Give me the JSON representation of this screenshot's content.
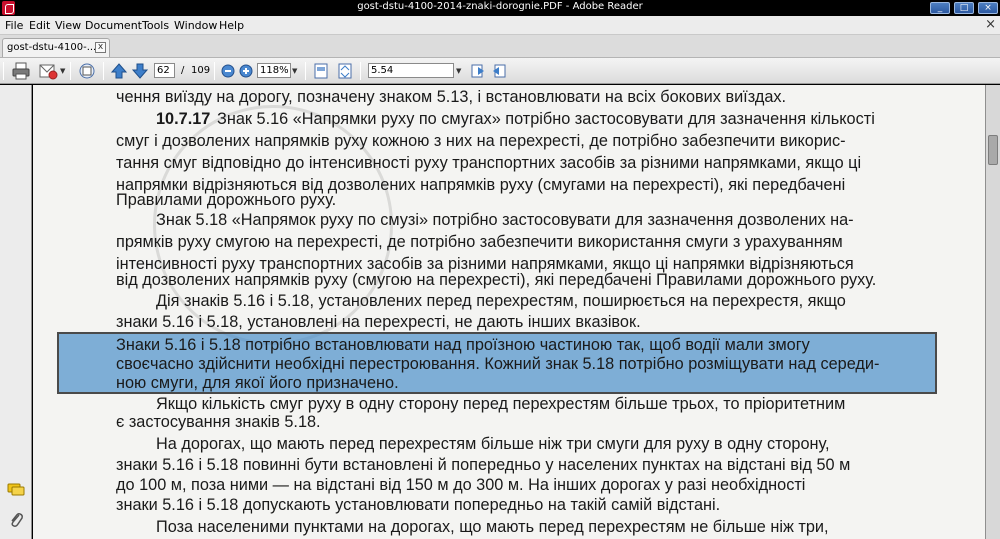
{
  "window": {
    "title": "gost-dstu-4100-2014-znaki-dorognie.PDF - Adobe Reader",
    "minimize": "_",
    "maximize": "□",
    "close": "×"
  },
  "menu": {
    "items": [
      "File",
      "Edit",
      "View",
      "Document",
      "Tools",
      "Window",
      "Help"
    ],
    "close": "×"
  },
  "tab": {
    "label": "gost-dstu-4100-...",
    "close": "x"
  },
  "toolbar": {
    "page_current": "62",
    "page_separator": "/",
    "page_total": "109",
    "zoom": "118%",
    "search": "5.54"
  },
  "document": {
    "lines": [
      "чення виїзду на дорогу, позначену знаком 5.13, і встановлювати на всіх бокових виїздах.",
      "10.7.17",
      "Знак 5.16 «Напрямки руху по смугах» потрібно застосовувати для зазначення кількості",
      "смуг і дозволених напрямків руху кожною з них на перехресті, де потрібно забезпечити викорис-",
      "тання смуг відповідно до інтенсивності руху транспортних засобів за різними напрямками, якщо ці",
      "напрямки відрізняються від дозволених напрямків руху (смугами на перехресті), які передбачені",
      "Правилами дорожнього руху.",
      "Знак 5.18 «Напрямок руху по смузі» потрібно застосовувати для зазначення дозволених на-",
      "прямків руху смугою на перехресті, де потрібно забезпечити використання смуги з урахуванням",
      "інтенсивності руху транспортних засобів за різними напрямками, якщо ці напрямки відрізняються",
      "від дозволених напрямків руху (смугою на перехресті), які передбачені Правилами дорожнього руху.",
      "Дія знаків 5.16 і 5.18, установлених перед перехрестям, поширюється на перехрестя, якщо",
      "знаки 5.16 і 5.18, установлені на перехресті, не дають інших вказівок.",
      "Знаки 5.16 і 5.18 потрібно встановлювати над проїзною частиною так, щоб водії мали змогу",
      "своєчасно здійснити необхідні перестроювання. Кожний знак 5.18 потрібно розміщувати над середи-",
      "ною смуги, для якої його призначено.",
      "Якщо кількість смуг руху в одну сторону перед перехрестям більше трьох, то пріоритетним",
      "є застосування знаків 5.18.",
      "На дорогах, що мають перед перехрестям більше ніж три смуги для руху в одну сторону,",
      "знаки 5.16 і 5.18 повинні бути встановлені й попередньо у населених пунктах на відстані від 50 м",
      "до 100 м, поза ними — на відстані від 150 м до 300 м. На інших дорогах у разі необхідності",
      "знаки 5.16 і 5.18 допускають установлювати попередньо на такій самій відстані.",
      "Поза населеними пунктами на дорогах, що мають перед перехрестям не більше ніж три,"
    ]
  },
  "icons": {
    "app": "adobe-reader-icon",
    "print": "printer-icon",
    "email": "email-icon",
    "organize": "organize-icon",
    "prev_page": "up-arrow-icon",
    "next_page": "down-arrow-icon",
    "zoom_out": "zoom-out-icon",
    "zoom_in": "zoom-in-icon",
    "single_page": "single-page-icon",
    "fit_page": "fit-page-icon",
    "find_prev": "find-previous-icon",
    "find_next": "find-next-icon",
    "comments": "comments-icon",
    "attachments": "paperclip-icon"
  },
  "colors": {
    "highlight": "#468cc8",
    "titlebar": "#000000",
    "page": "#f4f4f2"
  }
}
